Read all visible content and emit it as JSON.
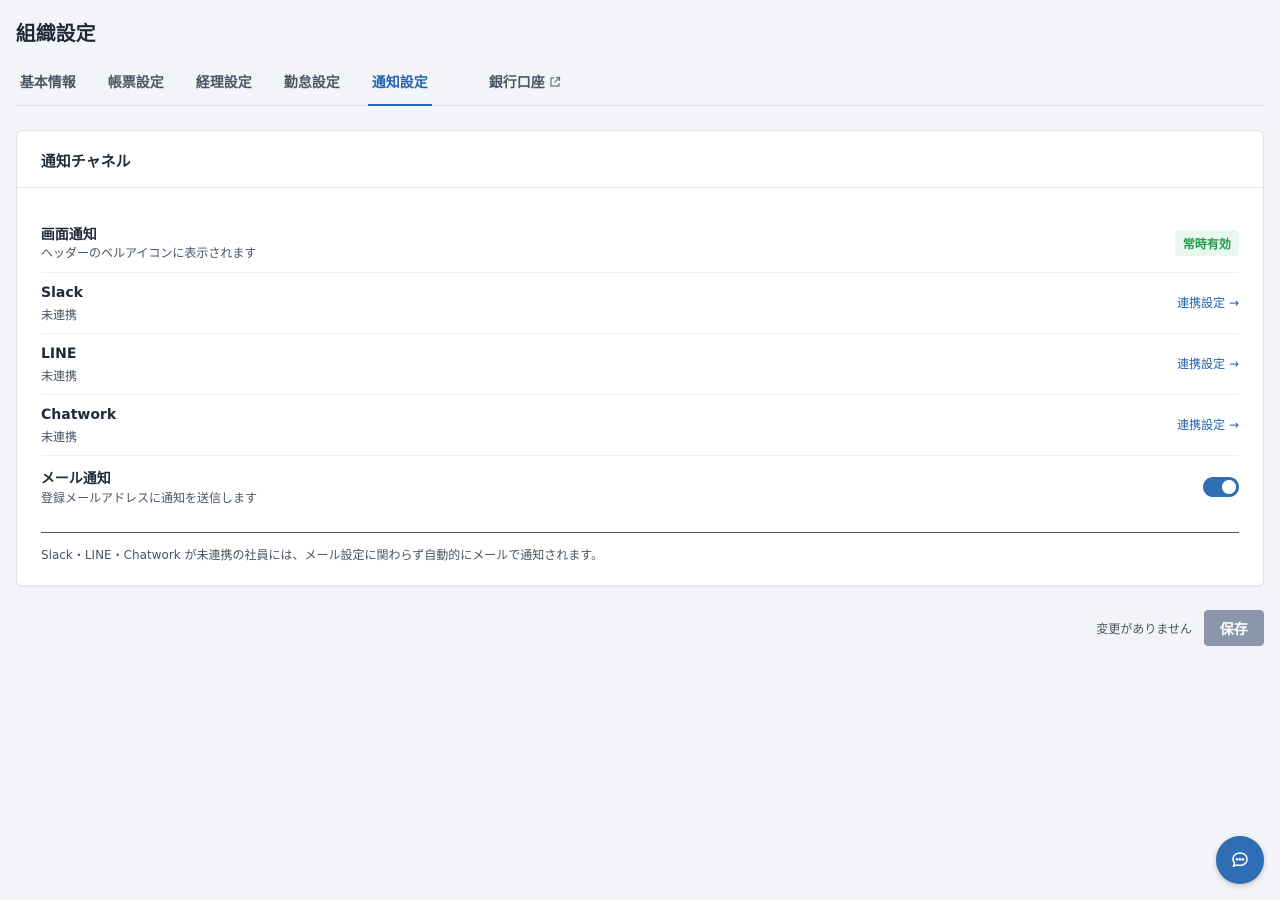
{
  "page": {
    "title": "組織設定"
  },
  "tabs": [
    {
      "label": "基本情報"
    },
    {
      "label": "帳票設定"
    },
    {
      "label": "経理設定"
    },
    {
      "label": "勤怠設定"
    },
    {
      "label": "通知設定",
      "active": true
    },
    {
      "label": "銀行口座",
      "external": true
    }
  ],
  "card": {
    "title": "通知チャネル",
    "rows": [
      {
        "name": "画面通知",
        "desc": "ヘッダーのベルアイコンに表示されます",
        "badge": "常時有効"
      },
      {
        "name": "Slack",
        "desc": "未連携",
        "action": "連携設定 →"
      },
      {
        "name": "LINE",
        "desc": "未連携",
        "action": "連携設定 →"
      },
      {
        "name": "Chatwork",
        "desc": "未連携",
        "action": "連携設定 →"
      },
      {
        "name": "メール通知",
        "desc": "登録メールアドレスに通知を送信します",
        "toggle_on": true
      }
    ],
    "note": "Slack・LINE・Chatwork が未連携の社員には、メール設定に関わらず自動的にメールで通知されます。"
  },
  "footer": {
    "status": "変更がありません",
    "save_label": "保存"
  },
  "colors": {
    "accent": "#2563ae",
    "badge_bg": "#eaf7ee",
    "badge_text": "#1f9d4a",
    "save_disabled": "#8a97ab"
  },
  "icons": {
    "external": "external-link-icon",
    "chat": "chat-bubble-icon"
  }
}
